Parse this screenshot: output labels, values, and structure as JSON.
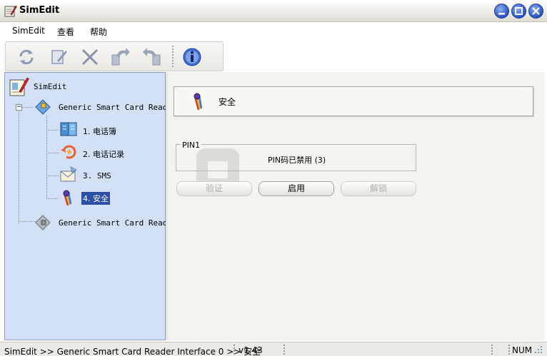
{
  "window": {
    "title": "SimEdit"
  },
  "menu": {
    "items": [
      "SimEdit",
      "查看",
      "帮助"
    ]
  },
  "toolbar": {
    "buttons": [
      "refresh-icon",
      "edit-icon",
      "delete-icon",
      "forward-icon",
      "back-icon",
      "info-icon"
    ]
  },
  "tree": {
    "root": "SimEdit",
    "reader1": "Generic Smart Card Reade",
    "children": [
      "1. 电话簿",
      "2. 电话记录",
      "3. SMS",
      "4. 安全"
    ],
    "reader2": "Generic Smart Card Reade",
    "expander": "−"
  },
  "content": {
    "header": "安全",
    "group_title": "PIN1",
    "pin_status": "PIN码已禁用 (3)",
    "buttons": {
      "verify": "验证",
      "enable": "启用",
      "unlock": "解锁"
    }
  },
  "statusbar": {
    "path": "SimEdit  >>  Generic Smart Card Reader Interface 0  >>  安全",
    "version": "v1.43",
    "num": "NUM"
  },
  "colors": {
    "tree_bg": "#d3e0f5",
    "selection": "#2c4fa8",
    "content_bg": "#f3f3ef",
    "titlebar_btn": "#2b58c8"
  }
}
